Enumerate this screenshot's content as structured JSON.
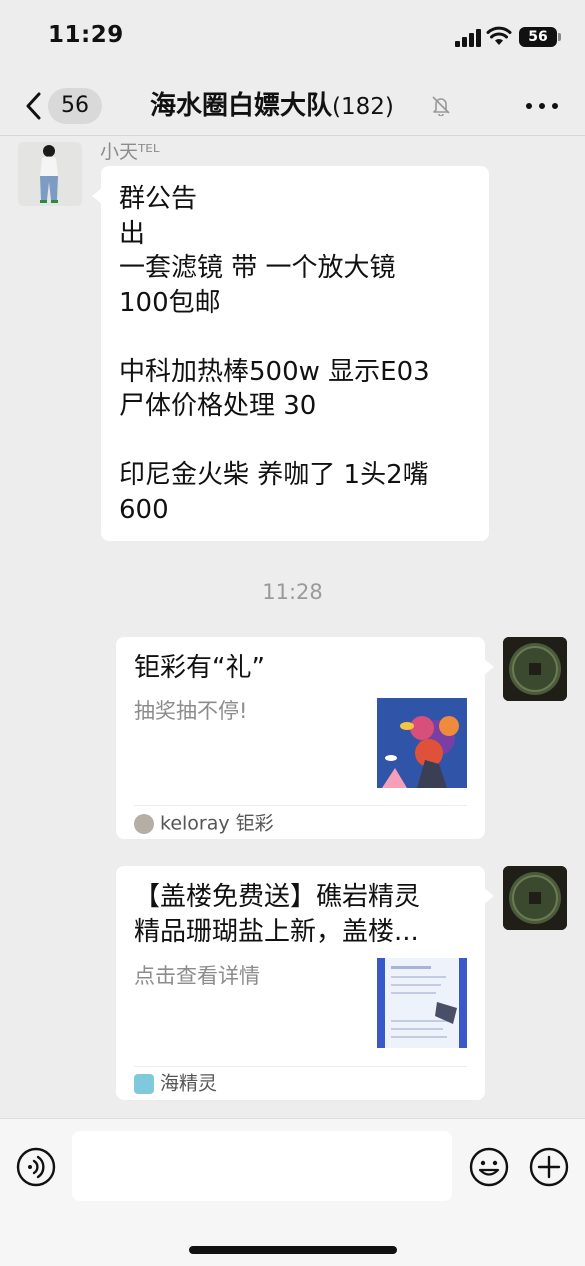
{
  "status_bar": {
    "time": "11:29",
    "battery": "56"
  },
  "nav": {
    "unread_count": "56",
    "title": "海水圈白嫖大队",
    "member_count": "(182)"
  },
  "messages": {
    "announcement": {
      "sender": "小天ᵀᴱᴸ",
      "text": "群公告\n出\n一套滤镜  带 一个放大镜\n100包邮\n\n中科加热棒500w 显示E03\n尸体价格处理 30\n\n印尼金火柴 养咖了 1头2嘴\n600"
    },
    "timestamp": "11:28",
    "card_1": {
      "title": "钜彩有“礼”",
      "description": "抽奖抽不停!",
      "source": "keloray 钜彩"
    },
    "card_2": {
      "title_line_1": "【盖楼免费送】礁岩精灵",
      "title_line_2": "精品珊瑚盐上新，盖楼...",
      "description": "点击查看详情",
      "source": "海精灵"
    }
  },
  "input_bar": {
    "placeholder": ""
  },
  "icons": {
    "back": "chevron-left-icon",
    "mute": "bell-slash-icon",
    "more": "more-dots-icon",
    "voice": "voice-icon",
    "emoji": "emoji-icon",
    "plus": "plus-icon"
  },
  "colors": {
    "background": "#ededed",
    "bubble": "#ffffff",
    "muted_text": "#8c8c8c"
  }
}
